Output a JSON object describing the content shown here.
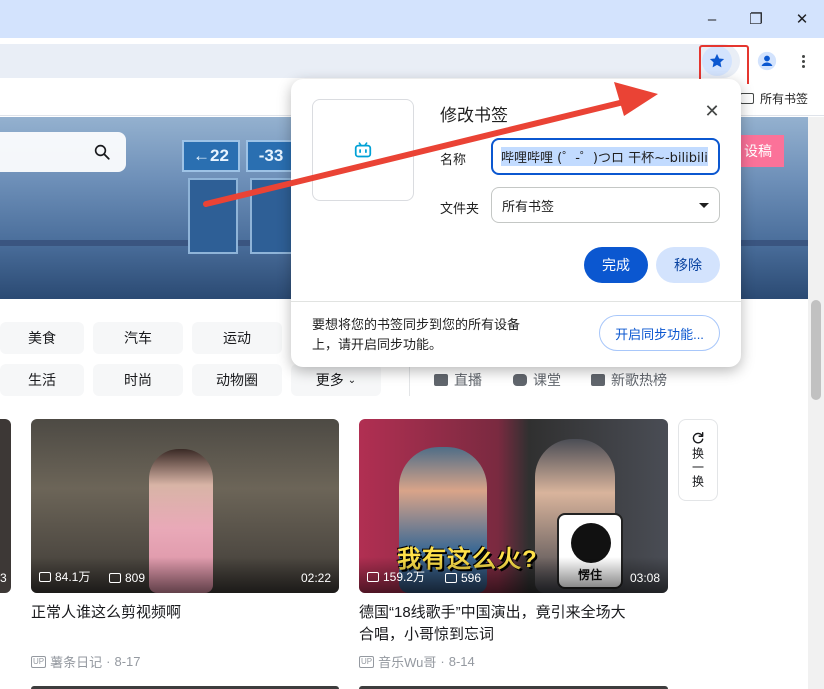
{
  "browser": {
    "window_controls": {
      "minimize": "–",
      "restore": "❐",
      "close": "✕"
    },
    "toolbar": {
      "star_icon": "star-filled-icon",
      "profile_icon": "profile-icon",
      "menu_icon": "kebab-menu-icon"
    },
    "bookmarks_bar": {
      "all_bookmarks_label": "所有书签"
    },
    "colors": {
      "star_blue": "#0b57d0",
      "highlight_red": "#e5362f"
    }
  },
  "page": {
    "banner": {
      "sign_left": "22",
      "sign_right": "33",
      "login_label": "设稿"
    },
    "categories": [
      {
        "label": "美食"
      },
      {
        "label": "汽车"
      },
      {
        "label": "运动"
      },
      {
        "label": "生活"
      },
      {
        "label": "时尚"
      },
      {
        "label": "动物圈"
      },
      {
        "label": "更多"
      }
    ],
    "quick_links": [
      {
        "label": "直播"
      },
      {
        "label": "课堂"
      },
      {
        "label": "新歌热榜"
      }
    ],
    "refresh": {
      "label": "换一换"
    },
    "videos": [
      {
        "views": "84.1万",
        "danmaku": "809",
        "duration": "02:22",
        "title": "正常人谁这么剪视频啊",
        "uploader": "薯条日记",
        "date": "8-17"
      },
      {
        "views": "159.2万",
        "danmaku": "596",
        "duration": "03:08",
        "title": "德国“18线歌手”中国演出，竟引来全场大合唱，小哥惊到忘词",
        "uploader": "音乐Wu哥",
        "date": "8-14",
        "thumb_caption": "我有这么火?",
        "thumb_sticker": "愣住"
      }
    ],
    "left_clip_stat": "3"
  },
  "dialog": {
    "title": "修改书签",
    "name_label": "名称",
    "name_value": "哔哩哔哩 (゜-゜)つロ 干杯~-bilibili",
    "folder_label": "文件夹",
    "folder_value": "所有书签",
    "done_label": "完成",
    "remove_label": "移除",
    "sync_text": "要想将您的书签同步到您的所有设备上，请开启同步功能。",
    "sync_button": "开启同步功能..."
  }
}
